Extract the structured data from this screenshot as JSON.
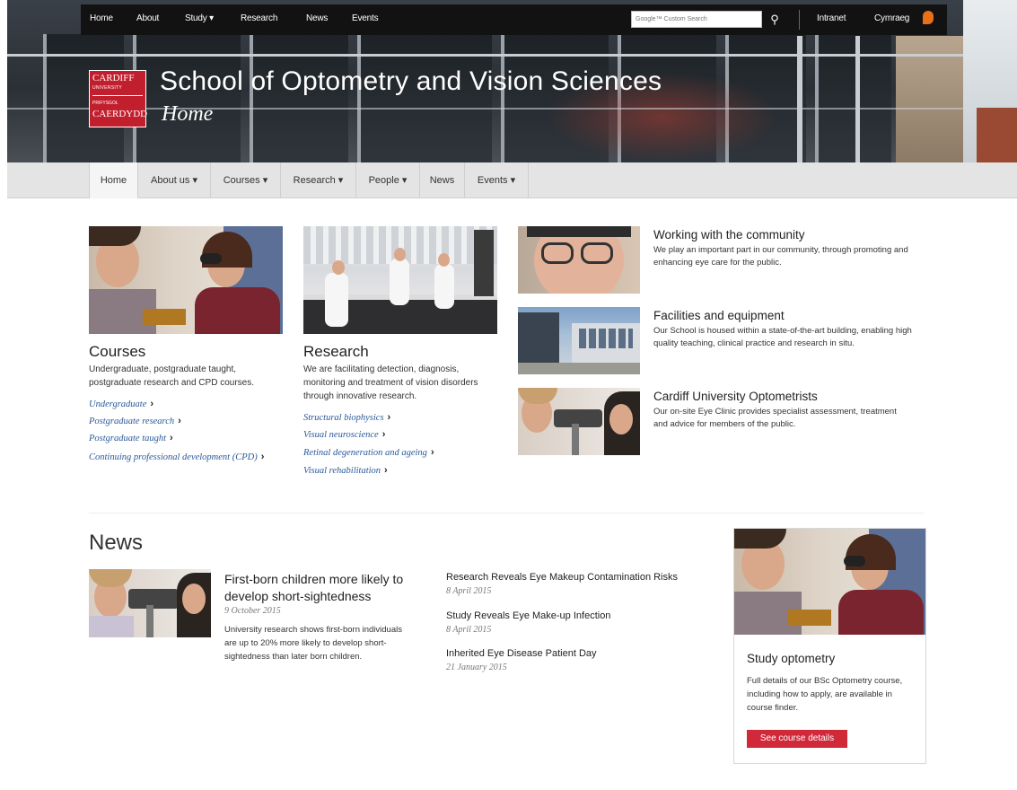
{
  "topbar": {
    "links": [
      "Home",
      "About",
      "Study ▾",
      "Research",
      "News",
      "Events"
    ],
    "search_placeholder": "Google™ Custom Search",
    "intranet": "Intranet",
    "welsh": "Cymraeg"
  },
  "logo": {
    "line1": "CARDIFF",
    "line2": "UNIVERSITY",
    "line3": "PRIFYSGOL",
    "line4": "CAERDYDD"
  },
  "header": {
    "title": "School of Optometry and Vision Sciences",
    "subtitle": "Home"
  },
  "subnav": [
    "Home",
    "About us ▾",
    "Courses ▾",
    "Research ▾",
    "People ▾",
    "News",
    "Events ▾"
  ],
  "courses": {
    "title": "Courses",
    "text": "Undergraduate, postgraduate taught, postgraduate research and CPD courses.",
    "links": [
      "Undergraduate",
      "Postgraduate research",
      "Postgraduate taught",
      "Continuing professional development (CPD)"
    ]
  },
  "research": {
    "title": "Research",
    "text": "We are facilitating detection, diagnosis, monitoring and treatment of vision disorders through innovative research.",
    "links": [
      "Structural biophysics",
      "Visual neuroscience",
      "Retinal degeneration and ageing",
      "Visual rehabilitation"
    ]
  },
  "features": [
    {
      "title": "Working with the community",
      "text": "We play an important part in our community, through promoting and enhancing eye care for the public."
    },
    {
      "title": "Facilities and equipment",
      "text": "Our School is housed within a state-of-the-art building, enabling high quality teaching, clinical practice and research in situ."
    },
    {
      "title": "Cardiff University Optometrists",
      "text": "Our on-site Eye Clinic provides specialist assessment, treatment and advice for members of the public."
    }
  ],
  "news": {
    "title": "News",
    "lead": {
      "headline": "First-born children more likely to develop short-sightedness",
      "date": "9 October 2015",
      "text": "University research shows first-born individuals are up to 20% more likely to develop short-sightedness than later born children."
    },
    "items": [
      {
        "headline": "Research Reveals Eye Makeup Contamination Risks",
        "date": "8 April 2015"
      },
      {
        "headline": "Study Reveals Eye Make-up Infection",
        "date": "8 April 2015"
      },
      {
        "headline": "Inherited Eye Disease Patient Day",
        "date": "21 January 2015"
      }
    ]
  },
  "study_card": {
    "title": "Study optometry",
    "text": "Full details of our BSc Optometry course, including how to apply, are available in course finder.",
    "button": "See course details"
  },
  "colors": {
    "brand_red": "#c21f2e",
    "button_red": "#d0293a",
    "link_blue": "#2a5a9a",
    "topbar_black": "#121212"
  }
}
